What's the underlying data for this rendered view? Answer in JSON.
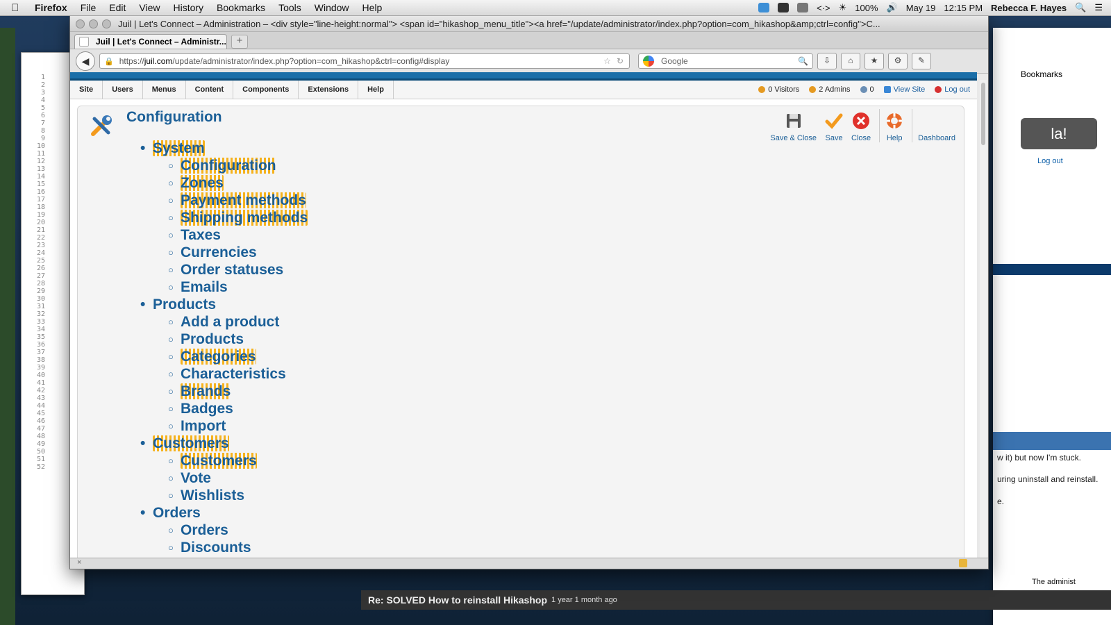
{
  "menubar": {
    "app": "Firefox",
    "items": [
      "File",
      "Edit",
      "View",
      "History",
      "Bookmarks",
      "Tools",
      "Window",
      "Help"
    ],
    "battery": "100%",
    "date": "May 19",
    "time": "12:15 PM",
    "user": "Rebecca F. Hayes"
  },
  "window": {
    "title": "Juil | Let's Connect – Administration – <div style=\"line-height:normal\"> <span id=\"hikashop_menu_title\"><a href=\"/update/administrator/index.php?option=com_hikashop&amp;ctrl=config\">C...",
    "tab_label": "Juil | Let's Connect – Administr...",
    "url_prefix": "https://",
    "url_domain": "juil.com",
    "url_rest": "/update/administrator/index.php?option=com_hikashop&ctrl=config#display",
    "search_placeholder": "Google"
  },
  "admin_menu": [
    "Site",
    "Users",
    "Menus",
    "Content",
    "Components",
    "Extensions",
    "Help"
  ],
  "status": {
    "visitors": "0 Visitors",
    "admins": "2 Admins",
    "messages": "0",
    "view_site": "View Site",
    "logout": "Log out"
  },
  "page": {
    "title": "Configuration"
  },
  "toolbar": {
    "save_close": "Save & Close",
    "save": "Save",
    "close": "Close",
    "help": "Help",
    "dashboard": "Dashboard"
  },
  "menu": {
    "system": "System",
    "system_items": [
      "Configuration",
      "Zones",
      "Payment methods",
      "Shipping methods",
      "Taxes",
      "Currencies",
      "Order statuses",
      "Emails"
    ],
    "products": "Products",
    "products_items": [
      "Add a product",
      "Products",
      "Categories",
      "Characteristics",
      "Brands",
      "Badges",
      "Import"
    ],
    "customers": "Customers",
    "customers_items": [
      "Customers",
      "Vote",
      "Wishlists"
    ],
    "orders": "Orders",
    "orders_items": [
      "Orders",
      "Discounts"
    ]
  },
  "background": {
    "bookmarks_label": "Bookmarks",
    "logout": "Log out",
    "forum_thread": "Re: SOLVED How to reinstall Hikashop",
    "forum_age": "1 year 1 month ago",
    "admin_snippet": "The administ",
    "text_lines": [
      "w it) but now I'm stuck.",
      "uring uninstall and reinstall.",
      "e."
    ]
  },
  "colors": {
    "accent": "#1b5f97",
    "highlight": "#f5b21d",
    "close_red": "#e0312b",
    "save_orange": "#f39a1d"
  }
}
